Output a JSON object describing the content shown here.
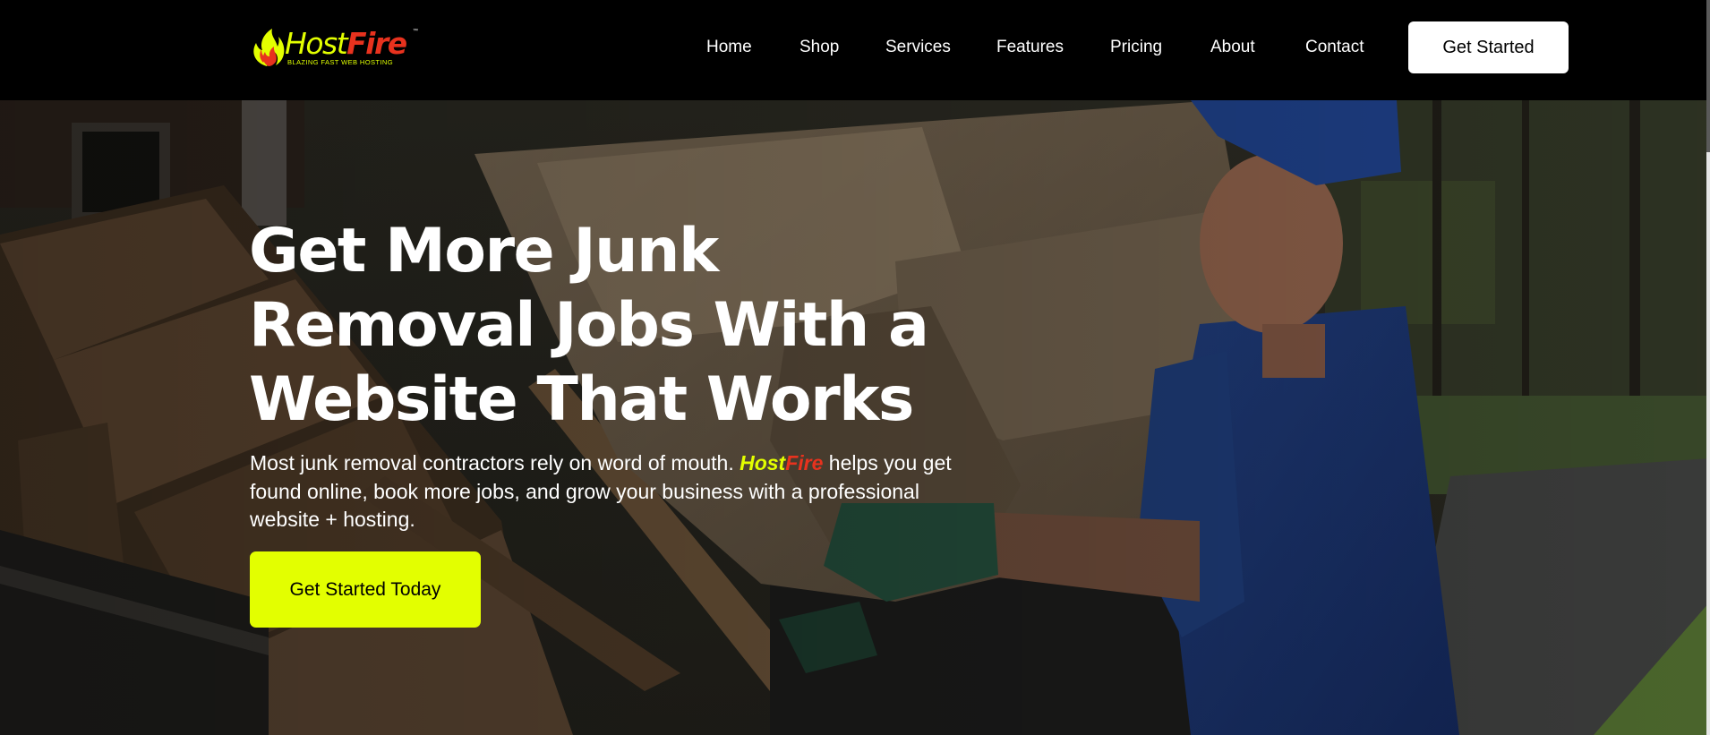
{
  "brand": {
    "host": "Host",
    "fire": "Fire",
    "tm": "™",
    "tagline": "BLAZING FAST WEB HOSTING",
    "colors": {
      "accent": "#e3ff00",
      "fire": "#e8321e",
      "header_bg": "#000000"
    }
  },
  "nav": {
    "items": [
      {
        "label": "Home"
      },
      {
        "label": "Shop"
      },
      {
        "label": "Services"
      },
      {
        "label": "Features"
      },
      {
        "label": "Pricing"
      },
      {
        "label": "About"
      },
      {
        "label": "Contact"
      }
    ],
    "cta_label": "Get Started"
  },
  "hero": {
    "title_line1": "Get More Junk",
    "title_line2": "Removal Jobs With a",
    "title_line3": "Website That Works",
    "sub_before": "Most junk removal contractors rely on word of mouth. ",
    "sub_brand_host": "Host",
    "sub_brand_fire": "Fire",
    "sub_after": " helps you get found online, book more jobs, and grow your business with a professional website + hosting.",
    "cta_label": "Get Started Today",
    "background_image": "worker in blue shirt and cap carrying a beige armchair onto a pile of junk and broken wood"
  }
}
